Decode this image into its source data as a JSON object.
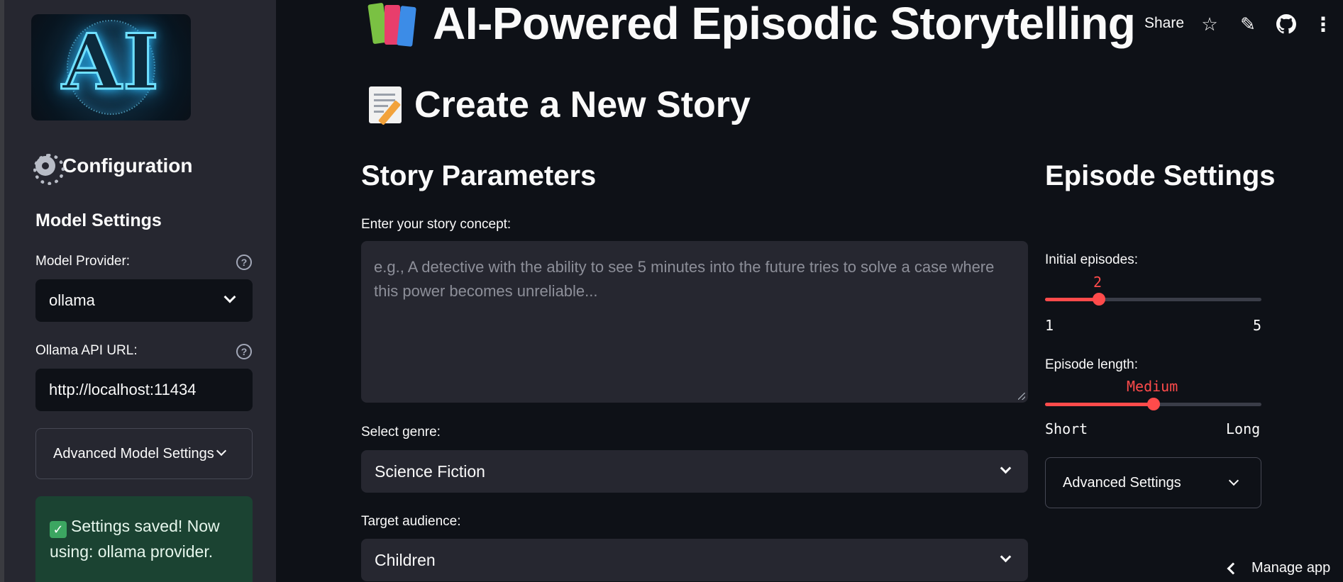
{
  "sidebar": {
    "logo_text": "AI",
    "config_title": "Configuration",
    "model_settings_heading": "Model Settings",
    "model_provider_label": "Model Provider:",
    "model_provider_value": "ollama",
    "api_url_label": "Ollama API URL:",
    "api_url_value": "http://localhost:11434",
    "advanced_model_settings_label": "Advanced Model Settings",
    "success_line1": "Settings saved! Now",
    "success_line2": "using: ollama provider."
  },
  "header": {
    "app_title": "AI-Powered Episodic Storytelling",
    "share_label": "Share",
    "icons": [
      "star-icon",
      "edit-icon",
      "github-icon",
      "more-icon"
    ]
  },
  "main": {
    "page_heading": "Create a New Story",
    "story_params_heading": "Story Parameters",
    "concept_label": "Enter your story concept:",
    "concept_placeholder": "e.g., A detective with the ability to see 5 minutes into the future tries to solve a case where this power becomes unreliable...",
    "genre_label": "Select genre:",
    "genre_value": "Science Fiction",
    "audience_label": "Target audience:",
    "audience_value": "Children"
  },
  "episode_settings": {
    "heading": "Episode Settings",
    "initial_episodes_label": "Initial episodes:",
    "initial_episodes_value": "2",
    "initial_episodes_min": "1",
    "initial_episodes_max": "5",
    "initial_episodes_fraction": 0.25,
    "episode_length_label": "Episode length:",
    "episode_length_value": "Medium",
    "episode_length_min": "Short",
    "episode_length_max": "Long",
    "episode_length_fraction": 0.5,
    "advanced_settings_label": "Advanced Settings"
  },
  "footer": {
    "manage_app_label": "Manage app"
  },
  "colors": {
    "accent": "#ff4b4b",
    "background": "#0e1117",
    "sidebar": "#262730",
    "success_bg": "#1b4332"
  }
}
